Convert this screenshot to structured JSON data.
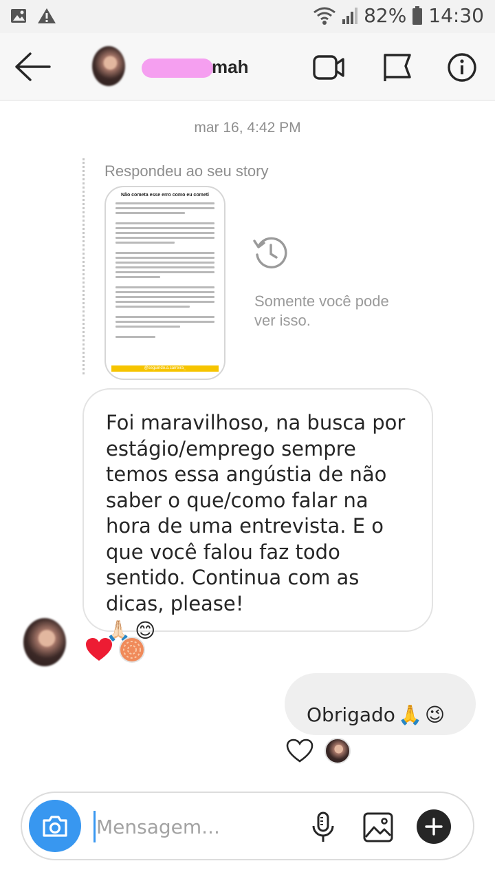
{
  "status_bar": {
    "battery": "82%",
    "time": "14:30"
  },
  "header": {
    "name_visible": "mah"
  },
  "conversation": {
    "timestamp": "mar 16, 4:42 PM",
    "reply_label": "Respondeu ao seu story",
    "story": {
      "title": "Não cometa esse erro como eu cometi",
      "footer": "@seguindo.a.carreira_"
    },
    "private_note": "Somente você pode ver isso.",
    "incoming_message": "Foi maravilhoso, na busca por estágio/emprego sempre temos essa angústia de não saber o que/como falar na hora de uma entrevista. E o que você falou faz todo sentido. Continua com as dicas, please!",
    "incoming_emojis": [
      "🙏🏻",
      "😊"
    ],
    "incoming_reactions": [
      "❤️"
    ],
    "outgoing_message": "Obrigado",
    "outgoing_emojis": [
      "🙏",
      "😉"
    ]
  },
  "composer": {
    "placeholder": "Mensagem..."
  },
  "icons": [
    "back-arrow-icon",
    "video-call-icon",
    "flag-icon",
    "info-icon",
    "history-icon",
    "heart-icon",
    "camera-icon",
    "microphone-icon",
    "gallery-icon",
    "plus-icon"
  ],
  "colors": {
    "accent": "#3897f0",
    "heart": "#ed1c33",
    "story_bar": "#f6c400"
  }
}
